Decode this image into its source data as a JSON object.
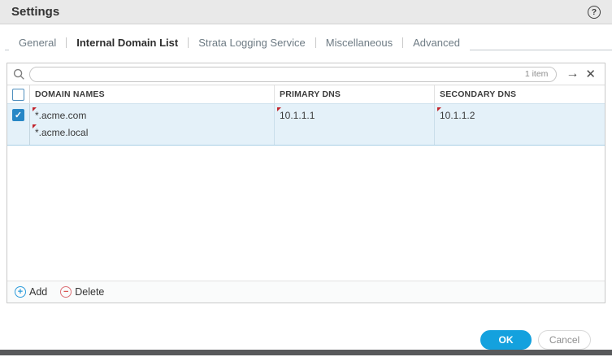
{
  "colors": {
    "accent_blue": "#14a1de",
    "checkbox_blue": "#2787c6",
    "row_highlight_bg": "#e4f1f9",
    "edited_marker_red": "#c2262e",
    "titlebar_bg": "#e9e9e9",
    "bottombar_bg": "#58595b"
  },
  "icons": {
    "help": "?",
    "arrow_right": "→",
    "close": "✕",
    "check": "✓",
    "add": "+",
    "delete": "−"
  },
  "window": {
    "title": "Settings"
  },
  "tabs": [
    {
      "label": "General",
      "active": false
    },
    {
      "label": "Internal Domain List",
      "active": true
    },
    {
      "label": "Strata Logging Service",
      "active": false
    },
    {
      "label": "Miscellaneous",
      "active": false
    },
    {
      "label": "Advanced",
      "active": false
    }
  ],
  "search": {
    "value": "",
    "count_label": "1 item"
  },
  "table": {
    "columns": [
      "DOMAIN NAMES",
      "PRIMARY DNS",
      "SECONDARY DNS"
    ],
    "rows": [
      {
        "selected": true,
        "domain_names": [
          "*.acme.com",
          "*.acme.local"
        ],
        "primary_dns": "10.1.1.1",
        "secondary_dns": "10.1.1.2"
      }
    ]
  },
  "footer": {
    "add_label": "Add",
    "delete_label": "Delete"
  },
  "actions": {
    "ok_label": "OK",
    "cancel_label": "Cancel"
  }
}
